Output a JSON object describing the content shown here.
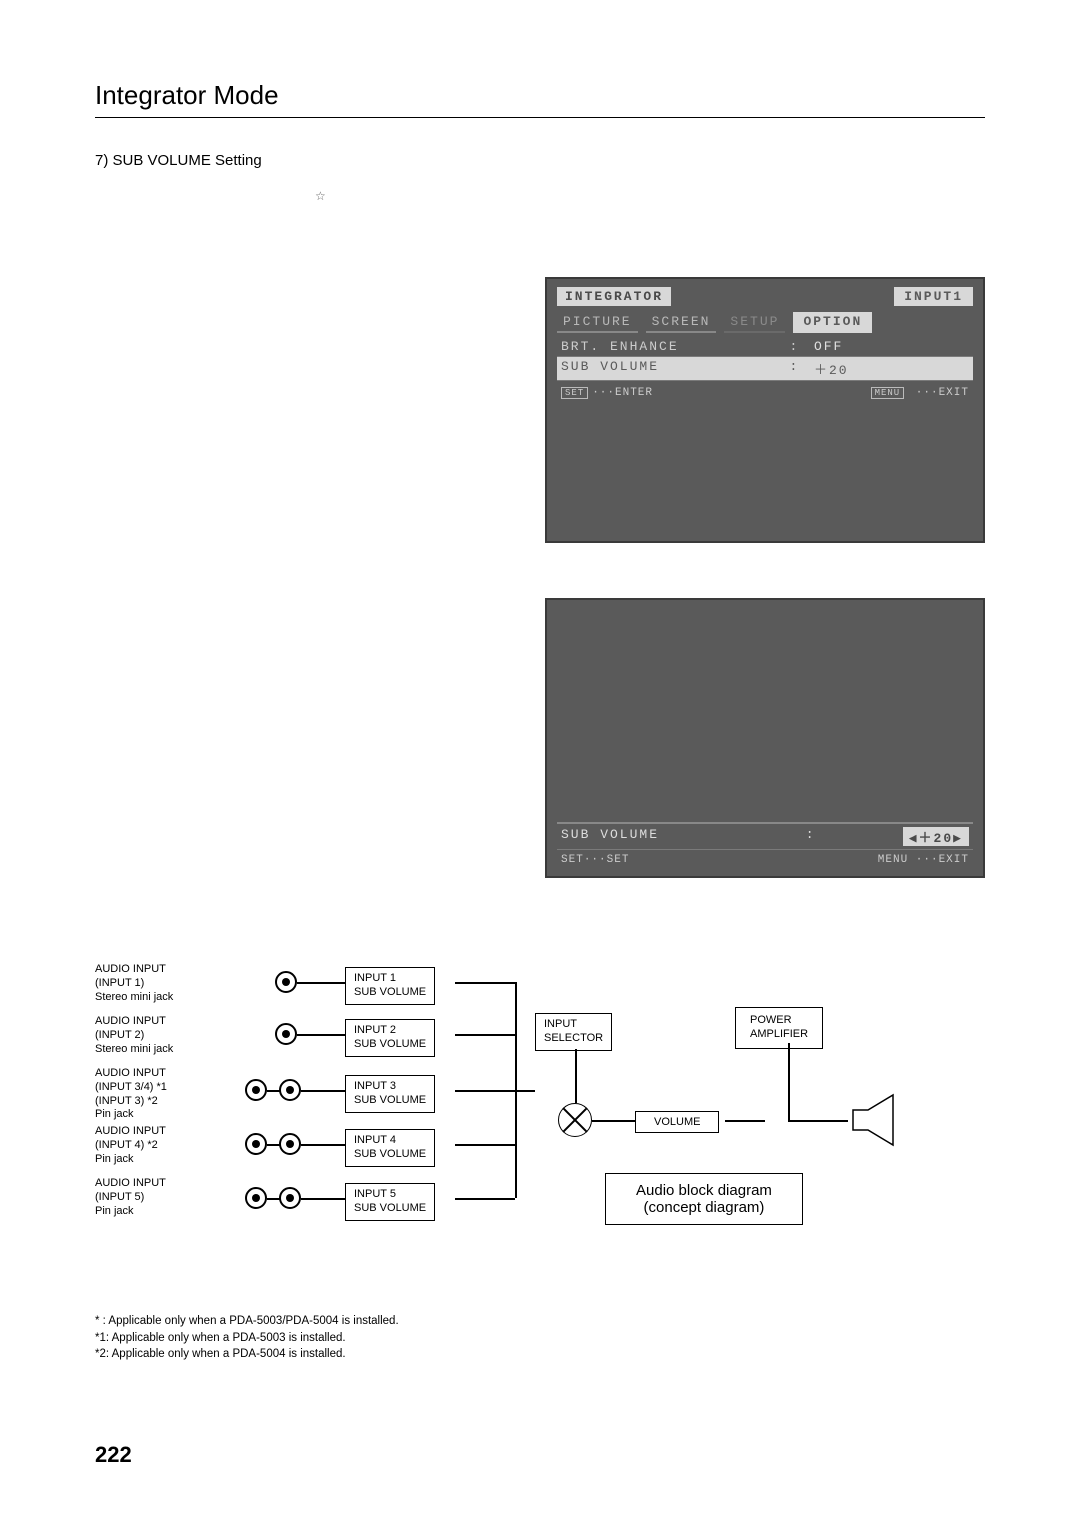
{
  "header": {
    "title": "Integrator Mode"
  },
  "section": {
    "title": "7) SUB VOLUME Setting"
  },
  "star": "☆",
  "osd1": {
    "left_label": "INTEGRATOR",
    "right_label": "INPUT1",
    "tabs": [
      "PICTURE",
      "SCREEN",
      "SETUP",
      "OPTION"
    ],
    "rows": [
      {
        "k": "BRT. ENHANCE",
        "s": ":",
        "v": "OFF",
        "hl": false
      },
      {
        "k": "SUB VOLUME",
        "s": ":",
        "v": "＋20",
        "hl": true
      }
    ],
    "footer_left_box": "SET",
    "footer_left": "···ENTER",
    "footer_right_box": "MENU",
    "footer_right": "···EXIT"
  },
  "osd2": {
    "row": {
      "k": "SUB VOLUME",
      "v": "◀＋20▶",
      "s": ":"
    },
    "footer_left_box": "SET",
    "footer_left": "···SET",
    "footer_right_box": "MENU",
    "footer_right": "···EXIT"
  },
  "diagram": {
    "inputs": [
      {
        "title": "AUDIO INPUT",
        "sub1": "(INPUT 1)",
        "sub2": "Stereo mini jack",
        "jacks": 1
      },
      {
        "title": "AUDIO INPUT",
        "sub1": "(INPUT 2)",
        "sub2": "Stereo mini jack",
        "jacks": 1
      },
      {
        "title": "AUDIO INPUT",
        "sub1": "(INPUT 3/4) *1",
        "sub2": "(INPUT 3) *2",
        "sub3": "Pin jack",
        "jacks": 2
      },
      {
        "title": "AUDIO INPUT",
        "sub1": "(INPUT 4) *2",
        "sub2": "Pin jack",
        "jacks": 2
      },
      {
        "title": "AUDIO INPUT",
        "sub1": "(INPUT 5)",
        "sub2": "Pin jack",
        "jacks": 2
      }
    ],
    "input_boxes": [
      "INPUT 1\nSUB VOLUME",
      "INPUT 2\nSUB VOLUME",
      "INPUT 3\nSUB VOLUME",
      "INPUT 4\nSUB VOLUME",
      "INPUT 5\nSUB VOLUME"
    ],
    "selector": "INPUT\nSELECTOR",
    "volume": "VOLUME",
    "amp": "POWER\nAMPLIFIER",
    "caption1": "Audio block diagram",
    "caption2": "(concept diagram)"
  },
  "footnotes": [
    "* : Applicable only when a PDA-5003/PDA-5004 is installed.",
    "*1: Applicable only when a PDA-5003 is installed.",
    "*2: Applicable only when a PDA-5004 is installed."
  ],
  "page_number": "222"
}
